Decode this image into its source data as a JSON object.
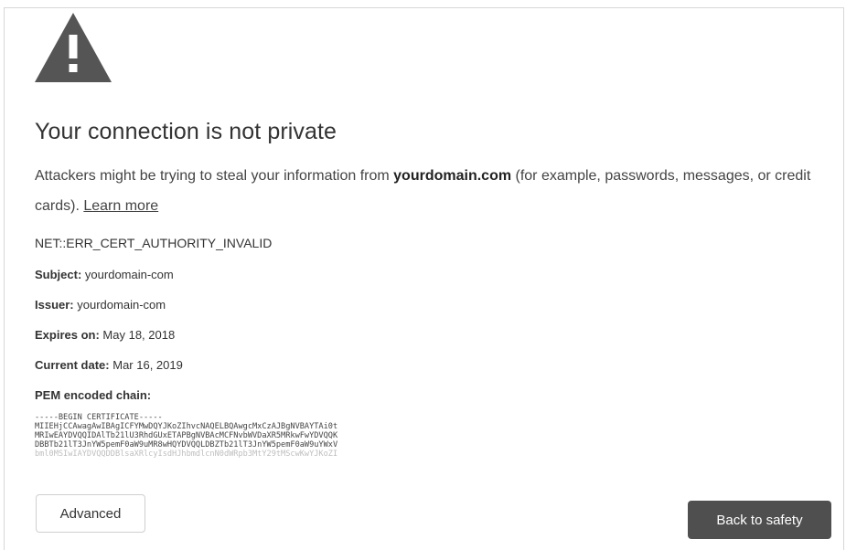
{
  "icon": "warning-triangle-icon",
  "colors": {
    "icon": "#555555",
    "primary_button": "#4f4f4f"
  },
  "title": "Your connection is not private",
  "intro": {
    "prefix": "Attackers might be trying to steal your information from ",
    "domain": "yourdomain.com",
    "suffix": " (for example, passwords, messages, or credit cards). ",
    "learn_more": "Learn more"
  },
  "error_code": "NET::ERR_CERT_AUTHORITY_INVALID",
  "details": [
    {
      "label": "Subject:",
      "value": "yourdomain-com"
    },
    {
      "label": "Issuer:",
      "value": "yourdomain-com"
    },
    {
      "label": "Expires on:",
      "value": "May 18, 2018"
    },
    {
      "label": "Current date:",
      "value": "Mar 16, 2019"
    },
    {
      "label": "PEM encoded chain:",
      "value": ""
    }
  ],
  "pem_lines": [
    "-----BEGIN CERTIFICATE-----",
    "MIIEHjCCAwagAwIBAgICFYMwDQYJKoZIhvcNAQELBQAwgcMxCzAJBgNVBAYTAi0t",
    "MRIwEAYDVQQIDAlTb21lU3RhdGUxETAPBgNVBAcMCFNvbWVDaXR5MRkwFwYDVQQK",
    "DBBTb21lT3JnYW5pemF0aW9uMR8wHQYDVQQLDBZTb21lT3JnYW5pemF0aW9uYWxV",
    "bml0MSIwIAYDVQQDDBlsaXRlcyIsdHJhbmdlcnN0dWRpb3MtY29tMScwKwYJKoZI"
  ],
  "buttons": {
    "advanced": "Advanced",
    "back": "Back to safety"
  }
}
